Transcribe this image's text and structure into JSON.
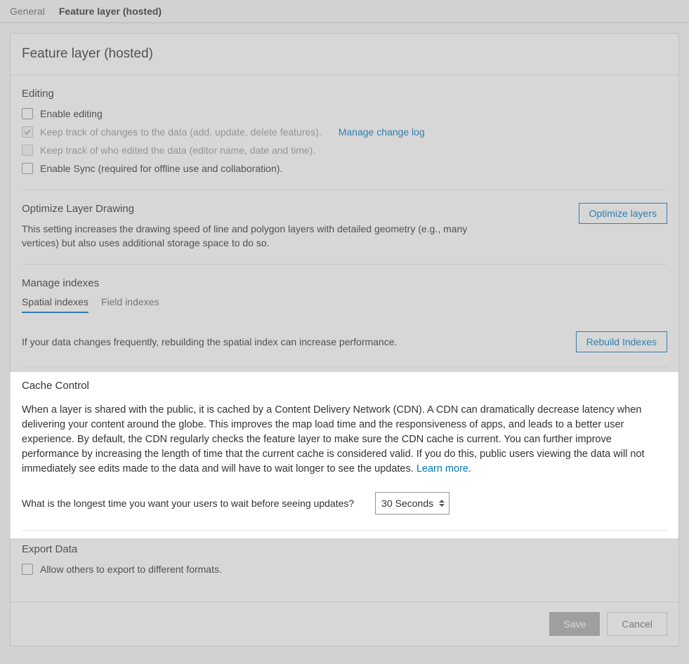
{
  "tabs": {
    "general": "General",
    "feature_layer": "Feature layer (hosted)"
  },
  "panel": {
    "title": "Feature layer (hosted)"
  },
  "editing": {
    "heading": "Editing",
    "enable_editing": "Enable editing",
    "track_changes": "Keep track of changes to the data (add, update, delete features).",
    "manage_change_log": "Manage change log",
    "track_who": "Keep track of who edited the data (editor name, date and time).",
    "enable_sync": "Enable Sync (required for offline use and collaboration)."
  },
  "optimize": {
    "heading": "Optimize Layer Drawing",
    "desc": "This setting increases the drawing speed of line and polygon layers with detailed geometry (e.g., many vertices) but also uses additional storage space to do so.",
    "button": "Optimize layers"
  },
  "indexes": {
    "heading": "Manage indexes",
    "tab_spatial": "Spatial indexes",
    "tab_field": "Field indexes",
    "desc": "If your data changes frequently, rebuilding the spatial index can increase performance.",
    "button": "Rebuild Indexes"
  },
  "cache": {
    "heading": "Cache Control",
    "para": "When a layer is shared with the public, it is cached by a Content Delivery Network (CDN). A CDN can dramatically decrease latency when delivering your content around the globe. This improves the map load time and the responsiveness of apps, and leads to a better user experience. By default, the CDN regularly checks the feature layer to make sure the CDN cache is current. You can further improve performance by increasing the length of time that the current cache is considered valid. If you do this, public users viewing the data will not immediately see edits made to the data and will have to wait longer to see the updates. ",
    "learn_more": "Learn more",
    "period": ".",
    "question": "What is the longest time you want your users to wait before seeing updates?",
    "selected": "30 Seconds"
  },
  "export": {
    "heading": "Export Data",
    "allow": "Allow others to export to different formats."
  },
  "footer": {
    "save": "Save",
    "cancel": "Cancel"
  }
}
